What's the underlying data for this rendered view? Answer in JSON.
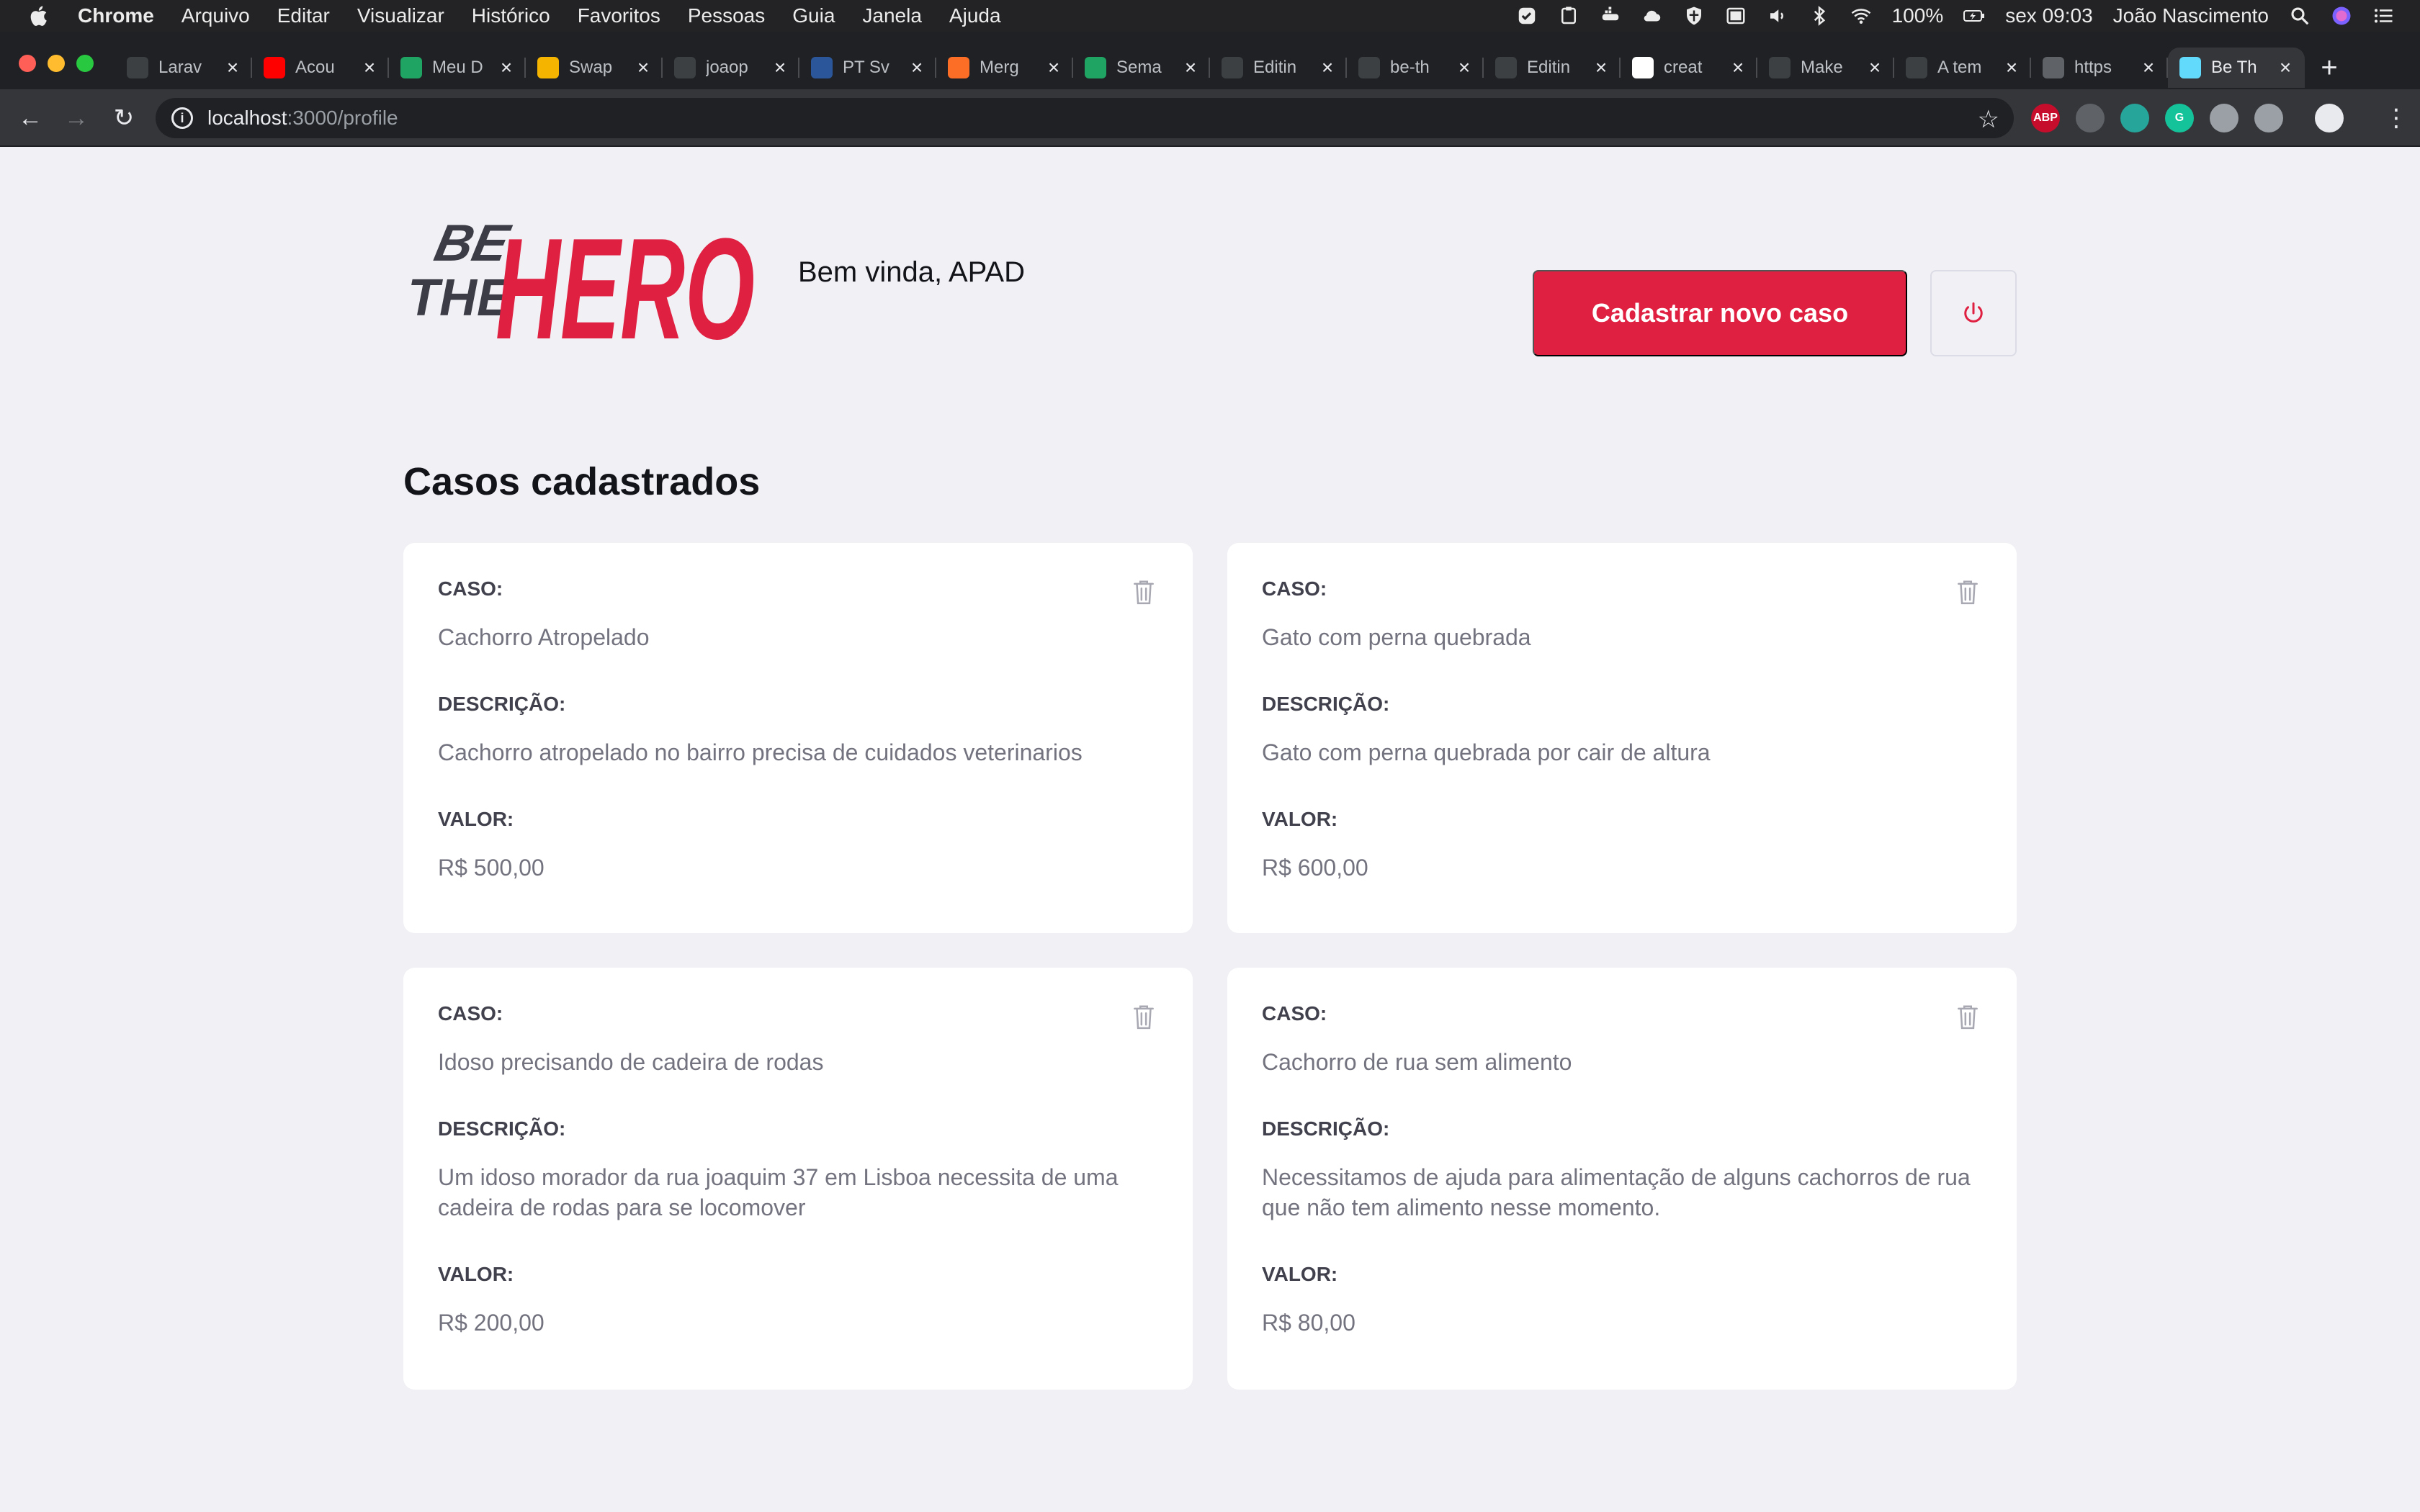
{
  "menubar": {
    "app_name": "Chrome",
    "menus": [
      "Arquivo",
      "Editar",
      "Visualizar",
      "Histórico",
      "Favoritos",
      "Pessoas",
      "Guia",
      "Janela",
      "Ajuda"
    ],
    "battery": "100%",
    "clock": "sex 09:03",
    "user": "João Nascimento"
  },
  "tabs": [
    {
      "title": "Larav",
      "favicon": "chat-icon",
      "color": "#3c4043"
    },
    {
      "title": "Acou",
      "favicon": "youtube-icon",
      "color": "#ff0000"
    },
    {
      "title": "Meu D",
      "favicon": "google-drive-icon",
      "color": "#1fa463"
    },
    {
      "title": "Swap",
      "favicon": "google-slides-icon",
      "color": "#f4b400"
    },
    {
      "title": "joaop",
      "favicon": "github-icon",
      "color": "#3c4043"
    },
    {
      "title": "PT Sv",
      "favicon": "word-icon",
      "color": "#2b579a"
    },
    {
      "title": "Merg",
      "favicon": "gitlab-icon",
      "color": "#fc6d26"
    },
    {
      "title": "Sema",
      "favicon": "google-drive-icon",
      "color": "#1fa463"
    },
    {
      "title": "Editin",
      "favicon": "github-icon",
      "color": "#3c4043"
    },
    {
      "title": "be-th",
      "favicon": "github-icon",
      "color": "#3c4043"
    },
    {
      "title": "Editin",
      "favicon": "github-icon",
      "color": "#3c4043"
    },
    {
      "title": "creat",
      "favicon": "google-icon",
      "color": "#ffffff"
    },
    {
      "title": "Make",
      "favicon": "document-icon",
      "color": "#3c4043"
    },
    {
      "title": "A tem",
      "favicon": "github-icon",
      "color": "#3c4043"
    },
    {
      "title": "https",
      "favicon": "globe-icon",
      "color": "#5f6368"
    },
    {
      "title": "Be Th",
      "favicon": "react-icon",
      "color": "#61dafb",
      "active": true
    }
  ],
  "toolbar": {
    "url_host": "localhost",
    "url_path": ":3000/profile",
    "extensions": [
      {
        "name": "adblock-icon",
        "text": "ABP",
        "color": "#c70d2c"
      },
      {
        "name": "extension-icon",
        "text": "",
        "color": "#5f6368"
      },
      {
        "name": "extension-teal-icon",
        "text": "",
        "color": "#26a69a"
      },
      {
        "name": "grammarly-icon",
        "text": "G",
        "color": "#15c39a"
      },
      {
        "name": "extension-badge-icon",
        "text": "",
        "color": "#9aa0a6"
      },
      {
        "name": "vue-devtools-icon",
        "text": "",
        "color": "#9aa0a6"
      },
      {
        "name": "profile-avatar-icon",
        "text": "",
        "color": "#e8eaed"
      }
    ]
  },
  "header": {
    "logo_line1": "BE",
    "logo_line2": "THE",
    "logo_word": "HERO",
    "greeting": "Bem vinda, APAD",
    "new_case_label": "Cadastrar novo caso"
  },
  "main": {
    "section_title": "Casos cadastrados",
    "labels": {
      "case": "CASO:",
      "description": "DESCRIÇÃO:",
      "value": "VALOR:"
    },
    "cases": [
      {
        "title": "Cachorro Atropelado",
        "description": "Cachorro atropelado no bairro precisa de cuidados veterinarios",
        "value": "R$ 500,00"
      },
      {
        "title": "Gato com perna quebrada",
        "description": "Gato com perna quebrada por cair de altura",
        "value": "R$ 600,00"
      },
      {
        "title": "Idoso precisando de cadeira de rodas",
        "description": "Um idoso morador da rua joaquim 37 em Lisboa necessita de uma cadeira de rodas para se locomover",
        "value": "R$ 200,00"
      },
      {
        "title": "Cachorro de rua sem alimento",
        "description": "Necessitamos de ajuda para alimentação de alguns cachorros de rua que não tem alimento nesse momento.",
        "value": "R$ 80,00"
      }
    ]
  },
  "colors": {
    "brand": "#e02041",
    "background": "#f0f0f5",
    "text_dark": "#13131a",
    "text_muted": "#737380",
    "label": "#41414d"
  }
}
